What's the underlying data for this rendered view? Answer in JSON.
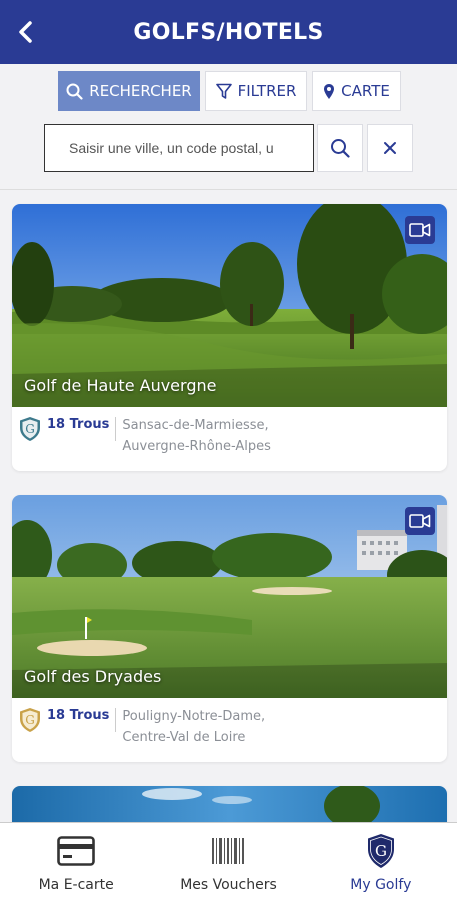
{
  "header": {
    "title": "GOLFS/HOTELS",
    "back_icon": "chevron-left-icon",
    "background": "#2a3b94"
  },
  "toolbar": {
    "search_label": "RECHERCHER",
    "filter_label": "FILTRER",
    "map_label": "CARTE",
    "search_placeholder": "Saisir une ville, un code postal, u",
    "search_value": "",
    "accent": "#6d88c7"
  },
  "courses": [
    {
      "name": "Golf de Haute Auvergne",
      "holes": "18 Trous",
      "location_line1": "Sansac-de-Marmiesse,",
      "location_line2": "Auvergne-Rhône-Alpes",
      "logo_color": "#3d7a8c",
      "has_video": true
    },
    {
      "name": "Golf des Dryades",
      "holes": "18 Trous",
      "location_line1": "Pouligny-Notre-Dame,",
      "location_line2": "Centre-Val de Loire",
      "logo_color": "#c9a24a",
      "has_video": true
    }
  ],
  "bottom_nav": {
    "items": [
      {
        "label": "Ma E-carte",
        "icon": "card-icon"
      },
      {
        "label": "Mes Vouchers",
        "icon": "barcode-icon"
      },
      {
        "label": "My Golfy",
        "icon": "golfy-shield-icon",
        "active": true
      }
    ]
  }
}
